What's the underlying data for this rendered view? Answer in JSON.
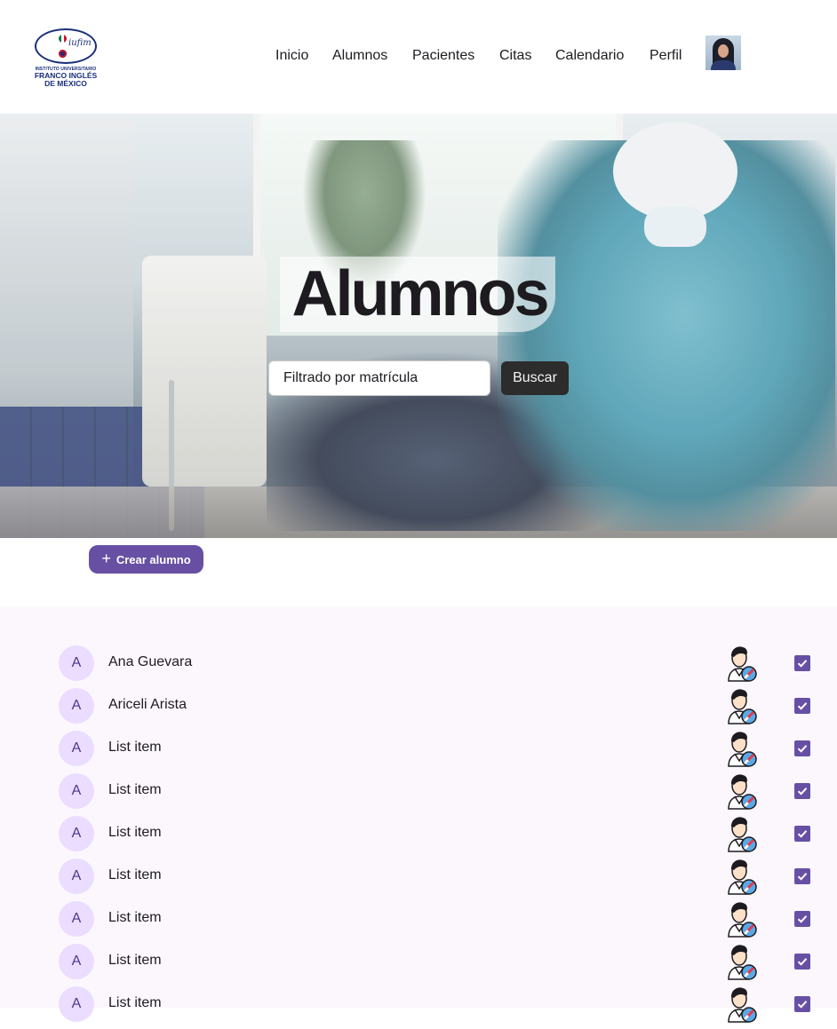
{
  "header": {
    "logo": {
      "script_text": "iufim",
      "small_text": "INSTITUTO UNIVERSITARIO",
      "line1": "FRANCO INGLÉS",
      "line2": "DE MÉXICO"
    },
    "nav": [
      "Inicio",
      "Alumnos",
      "Pacientes",
      "Citas",
      "Calendario",
      "Perfil"
    ]
  },
  "hero": {
    "title": "Alumnos",
    "search_placeholder": "Filtrado por matrícula",
    "search_button": "Buscar"
  },
  "create_button": "Crear alumno",
  "list": {
    "items": [
      {
        "initial": "A",
        "label": "Ana Guevara",
        "checked": true
      },
      {
        "initial": "A",
        "label": "Ariceli Arista",
        "checked": true
      },
      {
        "initial": "A",
        "label": "List item",
        "checked": true
      },
      {
        "initial": "A",
        "label": "List item",
        "checked": true
      },
      {
        "initial": "A",
        "label": "List item",
        "checked": true
      },
      {
        "initial": "A",
        "label": "List item",
        "checked": true
      },
      {
        "initial": "A",
        "label": "List item",
        "checked": true
      },
      {
        "initial": "A",
        "label": "List item",
        "checked": true
      },
      {
        "initial": "A",
        "label": "List item",
        "checked": true
      }
    ],
    "row_icon": "student-edit-icon"
  },
  "colors": {
    "primary": "#6750a4",
    "avatar_bg": "#eaddff",
    "list_bg": "#fcf7fd",
    "search_button_bg": "#2c2c2c"
  }
}
